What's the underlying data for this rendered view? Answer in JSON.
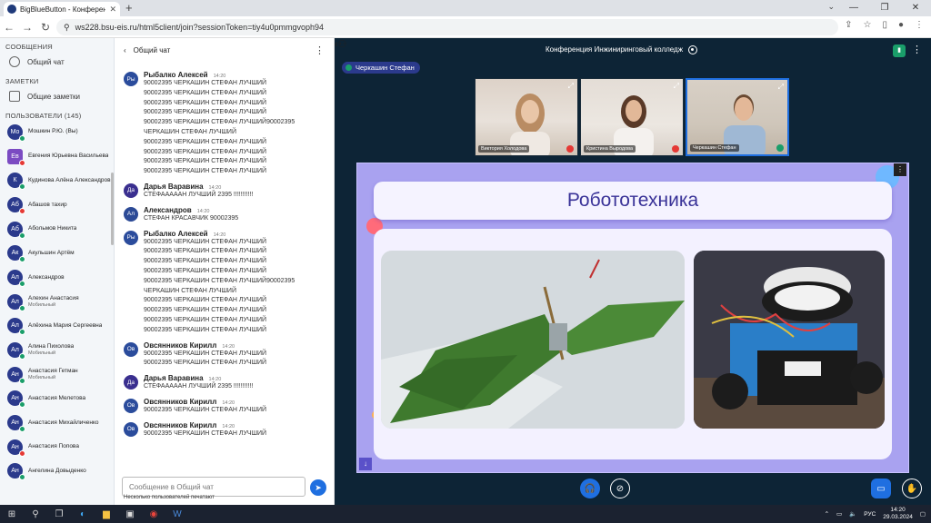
{
  "browser": {
    "tab_title": "BigBlueButton - Конферен...",
    "url": "ws228.bsu-eis.ru/html5client/join?sessionToken=tiy4u0pmmgvoph94"
  },
  "sidebar": {
    "messages_header": "СООБЩЕНИЯ",
    "public_chat": "Общий чат",
    "notes_header": "ЗАМЕТКИ",
    "shared_notes": "Общие заметки",
    "users_header": "ПОЛЬЗОВАТЕЛИ (145)",
    "users": [
      {
        "initials": "Мо",
        "name": "Мошкин Р.Ю. (Вы)",
        "sub": "",
        "status": "ok",
        "square": false
      },
      {
        "initials": "Ев",
        "name": "Евгения Юрьевна Васильева",
        "sub": "",
        "status": "mute",
        "square": true
      },
      {
        "initials": "К",
        "name": "Кудинова Алёна Александровна",
        "sub": "",
        "status": "ok",
        "square": false
      },
      {
        "initials": "Аб",
        "name": "Абашов тахир",
        "sub": "",
        "status": "mute",
        "square": false
      },
      {
        "initials": "Аб",
        "name": "Абольмов Никита",
        "sub": "",
        "status": "ok",
        "square": false
      },
      {
        "initials": "Ак",
        "name": "Акульшин Артём",
        "sub": "",
        "status": "ok",
        "square": false
      },
      {
        "initials": "Ал",
        "name": "Александров",
        "sub": "",
        "status": "ok",
        "square": false
      },
      {
        "initials": "Ал",
        "name": "Алехин Анастасия",
        "sub": "Мобильный",
        "status": "ok",
        "square": false
      },
      {
        "initials": "Ал",
        "name": "Алёхина Мария Сергеевна",
        "sub": "",
        "status": "ok",
        "square": false
      },
      {
        "initials": "Ал",
        "name": "Алина Пихолова",
        "sub": "Мобильный",
        "status": "ok",
        "square": false
      },
      {
        "initials": "Ан",
        "name": "Анастасия Гетман",
        "sub": "Мобильный",
        "status": "ok",
        "square": false
      },
      {
        "initials": "Ан",
        "name": "Анастасия Мелетова",
        "sub": "",
        "status": "ok",
        "square": false
      },
      {
        "initials": "Ан",
        "name": "Анастасия Михайличенко",
        "sub": "",
        "status": "ok",
        "square": false
      },
      {
        "initials": "Ан",
        "name": "Анастасия Попова",
        "sub": "",
        "status": "mute",
        "square": false
      },
      {
        "initials": "Ан",
        "name": "Ангелина Довыденко",
        "sub": "",
        "status": "ok",
        "square": false
      }
    ]
  },
  "chat": {
    "title": "Общий чат",
    "messages": [
      {
        "initials": "Ры",
        "author": "Рыбалко Алексей",
        "time": "14:20",
        "text": "90002395 ЧЕРКАШИН СТЕФАН ЛУЧШИЙ\n90002395 ЧЕРКАШИН СТЕФАН ЛУЧШИЙ\n90002395 ЧЕРКАШИН СТЕФАН ЛУЧШИЙ\n90002395 ЧЕРКАШИН СТЕФАН ЛУЧШИЙ\n90002395 ЧЕРКАШИН СТЕФАН ЛУЧШИЙ90002395\nЧЕРКАШИН СТЕФАН ЛУЧШИЙ\n90002395 ЧЕРКАШИН СТЕФАН ЛУЧШИЙ\n90002395 ЧЕРКАШИН СТЕФАН ЛУЧШИЙ\n90002395 ЧЕРКАШИН СТЕФАН ЛУЧШИЙ\n90002395 ЧЕРКАШИН СТЕФАН ЛУЧШИЙ",
        "kind": "ry"
      },
      {
        "initials": "Да",
        "author": "Дарья Варавина",
        "time": "14:20",
        "text": "СТЕФАААААН ЛУЧШИЙ 2395 !!!!!!!!!!!",
        "kind": "dv"
      },
      {
        "initials": "Ал",
        "author": "Александров",
        "time": "14:20",
        "text": "СТЕФАН КРАСАВЧИК 90002395",
        "kind": "al"
      },
      {
        "initials": "Ры",
        "author": "Рыбалко Алексей",
        "time": "14:20",
        "text": "90002395 ЧЕРКАШИН СТЕФАН ЛУЧШИЙ\n90002395 ЧЕРКАШИН СТЕФАН ЛУЧШИЙ\n90002395 ЧЕРКАШИН СТЕФАН ЛУЧШИЙ\n90002395 ЧЕРКАШИН СТЕФАН ЛУЧШИЙ\n90002395 ЧЕРКАШИН СТЕФАН ЛУЧШИЙ90002395\nЧЕРКАШИН СТЕФАН ЛУЧШИЙ\n90002395 ЧЕРКАШИН СТЕФАН ЛУЧШИЙ\n90002395 ЧЕРКАШИН СТЕФАН ЛУЧШИЙ\n90002395 ЧЕРКАШИН СТЕФАН ЛУЧШИЙ\n90002395 ЧЕРКАШИН СТЕФАН ЛУЧШИЙ",
        "kind": "ry"
      },
      {
        "initials": "Ов",
        "author": "Овсянников Кирилл",
        "time": "14:20",
        "text": "90002395 ЧЕРКАШИН СТЕФАН ЛУЧШИЙ\n90002395 ЧЕРКАШИН СТЕФАН ЛУЧШИЙ",
        "kind": "ov"
      },
      {
        "initials": "Да",
        "author": "Дарья Варавина",
        "time": "14:20",
        "text": "СТЕФАААААН ЛУЧШИЙ 2395 !!!!!!!!!!!",
        "kind": "dv"
      },
      {
        "initials": "Ов",
        "author": "Овсянников Кирилл",
        "time": "14:20",
        "text": "90002395 ЧЕРКАШИН СТЕФАН ЛУЧШИЙ",
        "kind": "ov"
      },
      {
        "initials": "Ов",
        "author": "Овсянников Кирилл",
        "time": "14:20",
        "text": "90002395 ЧЕРКАШИН СТЕФАН ЛУЧШИЙ",
        "kind": "ov"
      }
    ],
    "input_placeholder": "Сообщение в Общий чат",
    "typing": "Несколько пользователей печатают"
  },
  "stage": {
    "conference_title": "Конференция Инжиниринговый колледж",
    "talker": "Черкашин Стефан",
    "videos": [
      {
        "name": "Виктория Холодова",
        "mic": "off"
      },
      {
        "name": "Кристина Выродова",
        "mic": "off"
      },
      {
        "name": "Черкашин Стефан",
        "mic": "on"
      }
    ],
    "slide_title": "Робототехника"
  },
  "taskbar": {
    "lang": "РУС",
    "time": "14:20",
    "date": "29.03.2024"
  },
  "colors": {
    "accent": "#1f6fe0",
    "avatar": "#2b3a8c",
    "stage_bg": "#0d2436",
    "slide_bg": "#a9a2f0",
    "talking": "#1a9e6a",
    "muted": "#e53935"
  }
}
